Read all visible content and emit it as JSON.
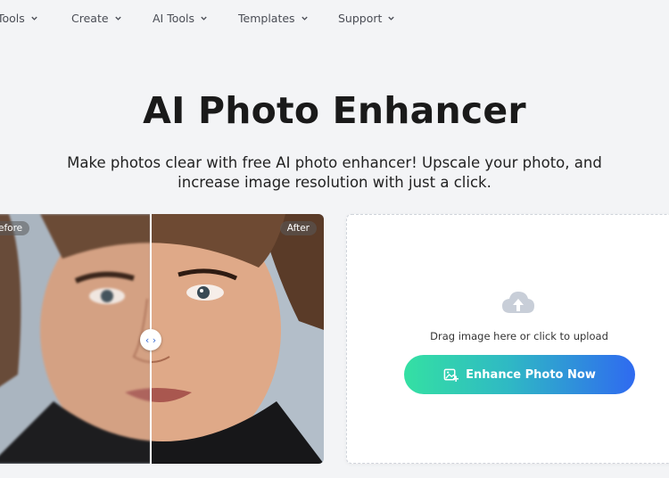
{
  "nav": {
    "items": [
      {
        "label": "Tools"
      },
      {
        "label": "Create"
      },
      {
        "label": "AI Tools"
      },
      {
        "label": "Templates"
      },
      {
        "label": "Support"
      }
    ]
  },
  "hero": {
    "title": "AI Photo Enhancer",
    "subtitle_line1": "Make photos clear with free AI photo enhancer! Upscale your photo, and",
    "subtitle_line2": "increase image resolution with just a click."
  },
  "compare": {
    "before_label": "efore",
    "after_label": "After",
    "handle_glyph": "‹ ›"
  },
  "upload": {
    "drag_text": "Drag image here or click to upload",
    "button_label": "Enhance Photo Now"
  },
  "colors": {
    "button_start": "#34e0a3",
    "button_end": "#2f6af0",
    "background": "#f3f4f6"
  }
}
